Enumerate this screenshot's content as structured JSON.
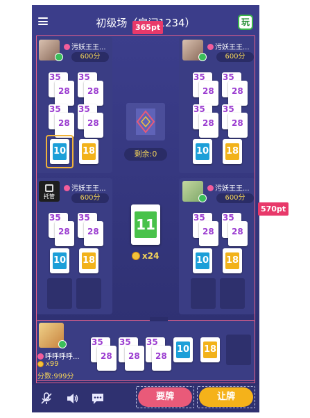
{
  "header": {
    "menu_icon": "menu-icon",
    "title": "初级场（房间1234）",
    "play_badge": "玩"
  },
  "annotations": {
    "width_label": "365pt",
    "height_label": "570pt"
  },
  "players": {
    "top_left": {
      "name": "污妖王王...",
      "score": "600分"
    },
    "top_right": {
      "name": "污妖王王...",
      "score": "600分"
    },
    "mid_left": {
      "name": "污妖王王...",
      "score": "600分",
      "badge": "托管"
    },
    "mid_right": {
      "name": "污妖王王...",
      "score": "600分"
    }
  },
  "tiles": {
    "n35": "35",
    "n28": "28",
    "n10": "10",
    "n18": "18",
    "n11": "11"
  },
  "center": {
    "remaining": "剩余:0",
    "multiplier": "x24"
  },
  "me": {
    "name": "呼呼呼呼...",
    "coins": "x99",
    "score": "分数:999分"
  },
  "actions": {
    "want_label": "要牌",
    "pass_label": "让牌"
  },
  "colors": {
    "accent": "#e95a79",
    "gold": "#f5b21a",
    "tile_blue": "#1c9fd8",
    "tile_yellow": "#f2b21a",
    "tile_green": "#48c24a"
  }
}
